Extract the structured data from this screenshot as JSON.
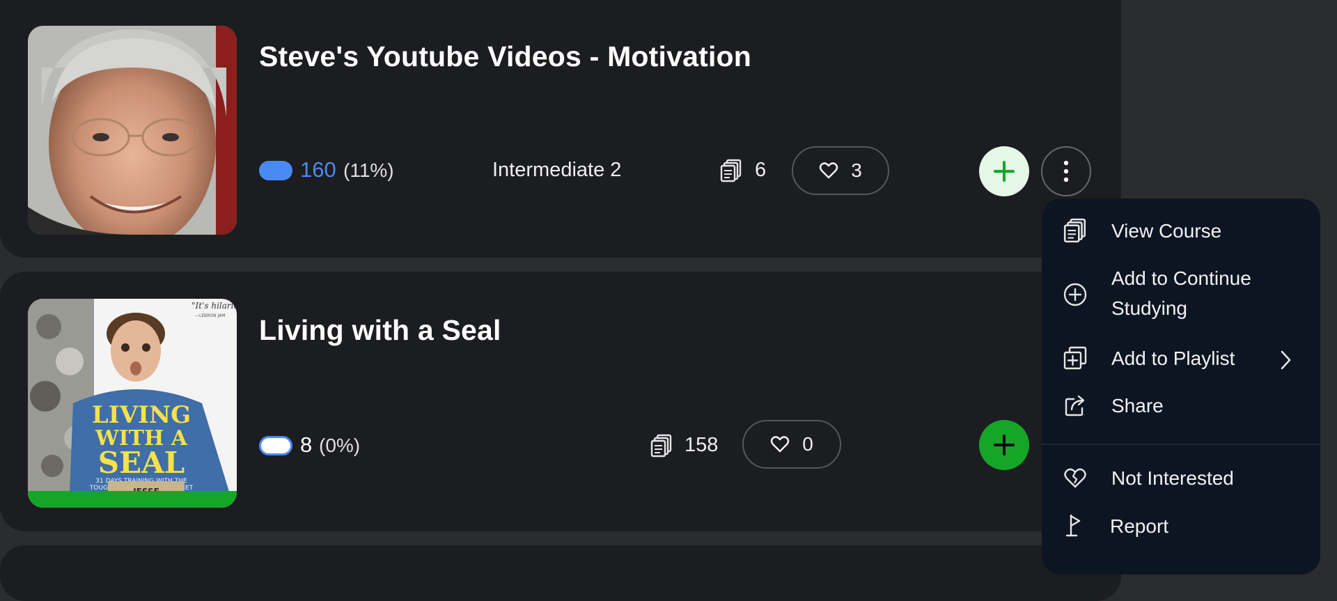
{
  "courses": [
    {
      "title": "Steve's Youtube Videos - Motivation",
      "known_count": "160",
      "known_percent": "(11%)",
      "level": "Intermediate 2",
      "lessons_count": "6",
      "likes": "3",
      "thumbnail": "portrait-photo"
    },
    {
      "title": "Living with a Seal",
      "known_count": "8",
      "known_percent": "(0%)",
      "level": "",
      "lessons_count": "158",
      "likes": "0",
      "thumbnail": "book-cover",
      "thumbnail_text": {
        "quote": "\"It's hilario",
        "quote_author": "—LEBRON JAM",
        "cover_title_1": "LIVING",
        "cover_title_2": "WITH A",
        "cover_title_3": "SEAL",
        "cover_sub_1": "31 DAYS TRAINING WITH THE",
        "cover_sub_2": "TOUGHEST MAN ON THE PLANET",
        "cover_bottom": "JESSE"
      },
      "progress_complete": 1.0
    }
  ],
  "menu": {
    "items": [
      {
        "label": "View Course",
        "icon": "lessons-icon"
      },
      {
        "label_line1": "Add to Continue",
        "label_line2": "Studying",
        "icon": "circle-plus-icon"
      },
      {
        "label": "Add to Playlist",
        "icon": "playlist-add-icon",
        "has_submenu": true
      },
      {
        "label": "Share",
        "icon": "share-icon"
      },
      {
        "label": "Not Interested",
        "icon": "broken-heart-icon"
      },
      {
        "label": "Report",
        "icon": "flag-icon"
      }
    ]
  },
  "colors": {
    "accent_blue": "#4a8af4",
    "accent_green": "#15a628",
    "card_bg": "#1c1d20",
    "menu_bg": "#0d1523"
  }
}
